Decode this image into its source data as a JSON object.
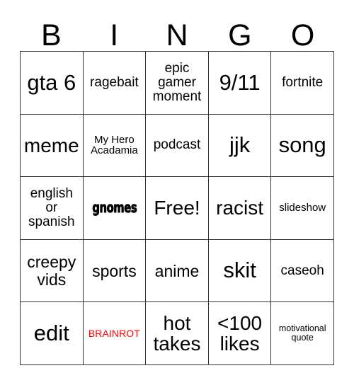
{
  "card": {
    "type": "bingo-card",
    "headers": [
      "B",
      "I",
      "N",
      "G",
      "O"
    ],
    "grid_size": 5,
    "colors": {
      "background": "#ffffff",
      "text": "#000000",
      "border": "#333333",
      "accent_red": "#ff0000"
    },
    "cells": [
      {
        "text": "gta 6",
        "size": "xl",
        "style": "normal"
      },
      {
        "text": "ragebait",
        "size": "sm",
        "style": "normal"
      },
      {
        "text": "epic gamer moment",
        "size": "sm",
        "style": "normal"
      },
      {
        "text": "9/11",
        "size": "xl",
        "style": "normal"
      },
      {
        "text": "fortnite",
        "size": "sm",
        "style": "normal"
      },
      {
        "text": "meme",
        "size": "lg",
        "style": "normal"
      },
      {
        "text": "My Hero Acadamia",
        "size": "xs",
        "style": "normal"
      },
      {
        "text": "podcast",
        "size": "sm",
        "style": "normal"
      },
      {
        "text": "jjk",
        "size": "xl",
        "style": "normal"
      },
      {
        "text": "song",
        "size": "xl",
        "style": "normal"
      },
      {
        "text": "english or spanish",
        "size": "sm",
        "style": "normal"
      },
      {
        "text": "gnomes",
        "size": "md",
        "style": "gnomes"
      },
      {
        "text": "Free!",
        "size": "lg",
        "style": "normal"
      },
      {
        "text": "racist",
        "size": "lg",
        "style": "normal"
      },
      {
        "text": "slideshow",
        "size": "xs",
        "style": "normal"
      },
      {
        "text": "creepy vids",
        "size": "md",
        "style": "normal"
      },
      {
        "text": "sports",
        "size": "md",
        "style": "normal"
      },
      {
        "text": "anime",
        "size": "md",
        "style": "normal"
      },
      {
        "text": "skit",
        "size": "xl",
        "style": "normal"
      },
      {
        "text": "caseoh",
        "size": "sm",
        "style": "normal"
      },
      {
        "text": "edit",
        "size": "xl",
        "style": "normal"
      },
      {
        "text": "BRAINROT",
        "size": "xxs",
        "style": "brainrot"
      },
      {
        "text": "hot takes",
        "size": "lg",
        "style": "normal"
      },
      {
        "text": "<100 likes",
        "size": "lg",
        "style": "normal"
      },
      {
        "text": "motivational quote",
        "size": "xxs",
        "style": "normal"
      }
    ]
  }
}
